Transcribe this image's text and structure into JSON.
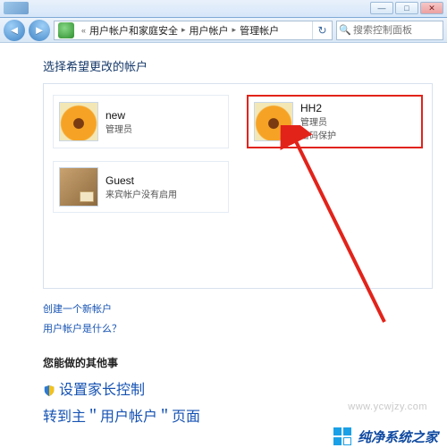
{
  "window": {
    "minimize": "—",
    "maximize": "□",
    "close": "✕"
  },
  "nav": {
    "back_glyph": "◄",
    "breadcrumb": {
      "seg1": "用户帐户和家庭安全",
      "seg2": "用户帐户",
      "seg3": "管理帐户",
      "separator": "▸"
    },
    "refresh_glyph": "↻",
    "search_placeholder": "搜索控制面板"
  },
  "page": {
    "title": "选择希望更改的帐户"
  },
  "accounts": [
    {
      "name": "new",
      "role": "管理员",
      "extra": "",
      "avatar": "flower",
      "highlight": false
    },
    {
      "name": "HH2",
      "role": "管理员",
      "extra": "密码保护",
      "avatar": "flower",
      "highlight": true
    },
    {
      "name": "Guest",
      "role": "来宾帐户没有启用",
      "extra": "",
      "avatar": "guest",
      "highlight": false
    }
  ],
  "links": {
    "create_account": "创建一个新帐户",
    "what_is_account": "用户帐户是什么？"
  },
  "other": {
    "heading": "您能做的其他事",
    "parental": "设置家长控制",
    "goto_main": "转到主＂用户帐户＂页面"
  },
  "watermark": {
    "url": "www.ycwjzy.com",
    "brand": "纯净系统之家"
  }
}
